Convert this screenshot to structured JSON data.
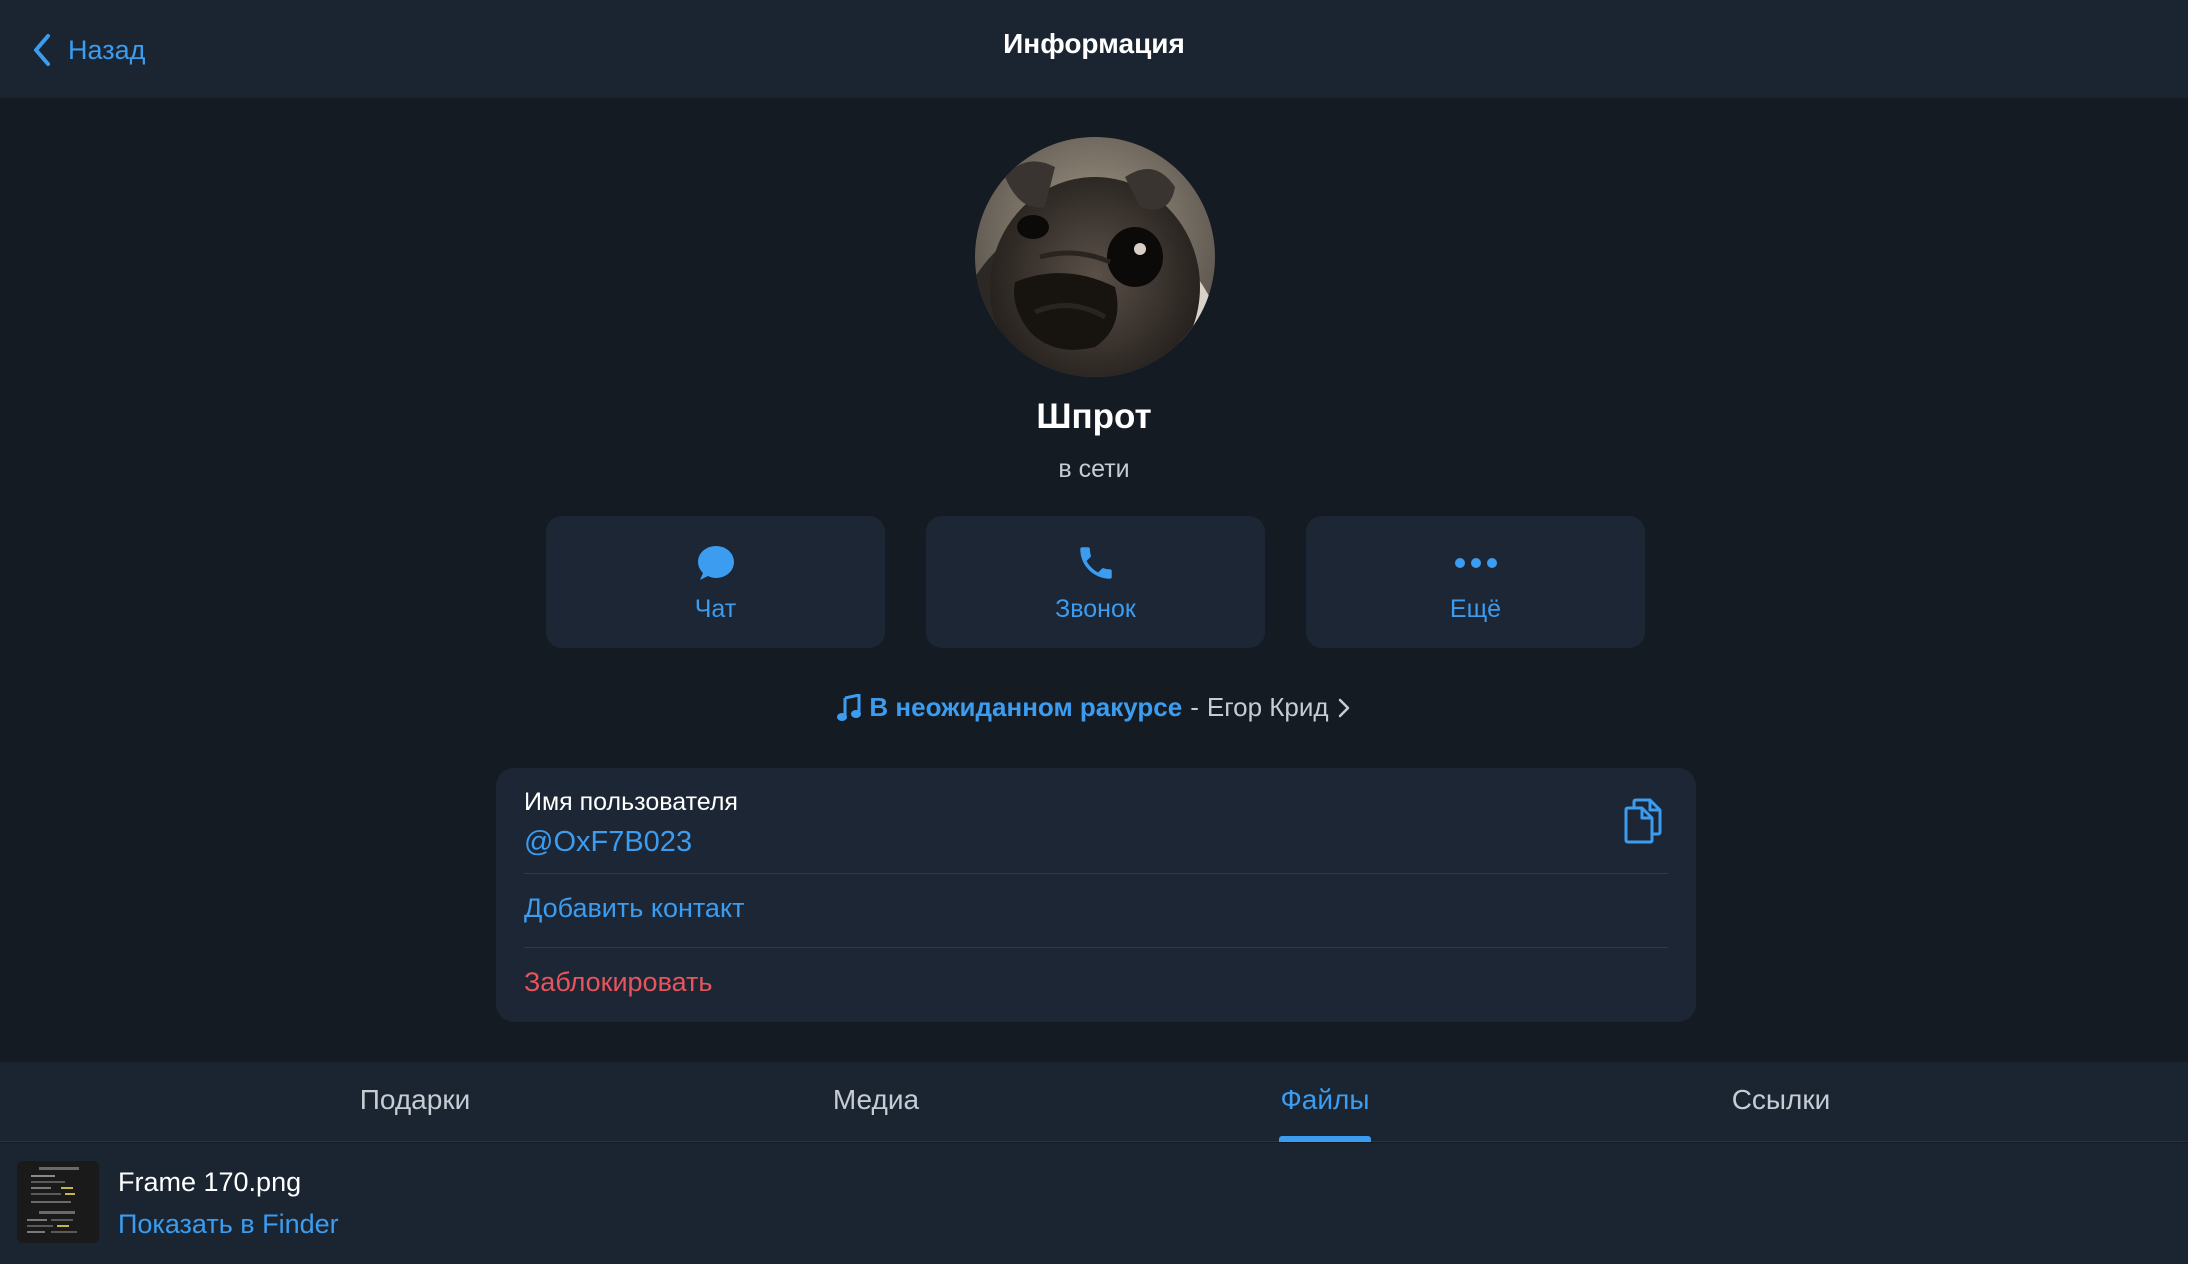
{
  "header": {
    "back_label": "Назад",
    "title": "Информация"
  },
  "profile": {
    "name": "Шпрот",
    "status": "в сети",
    "avatar": "pug-photo"
  },
  "actions": [
    {
      "label": "Чат",
      "icon": "chat-bubble-icon"
    },
    {
      "label": "Звонок",
      "icon": "phone-icon"
    },
    {
      "label": "Ещё",
      "icon": "more-dots-icon"
    }
  ],
  "music": {
    "icon": "music-note-icon",
    "track": "В неожиданном ракурсе",
    "separator": "-",
    "artist": "Егор Крид"
  },
  "info_card": {
    "username_label": "Имя пользователя",
    "username": "@OxF7B023",
    "add_contact": "Добавить контакт",
    "block": "Заблокировать"
  },
  "tabs": [
    {
      "label": "Подарки",
      "active": false
    },
    {
      "label": "Медиа",
      "active": false
    },
    {
      "label": "Файлы",
      "active": true
    },
    {
      "label": "Ссылки",
      "active": false
    }
  ],
  "files": [
    {
      "name": "Frame 170.png",
      "action": "Показать в Finder"
    }
  ],
  "colors": {
    "accent": "#3b9cf0",
    "danger": "#e8545c",
    "background": "#151b23",
    "panel": "#1c2635"
  }
}
